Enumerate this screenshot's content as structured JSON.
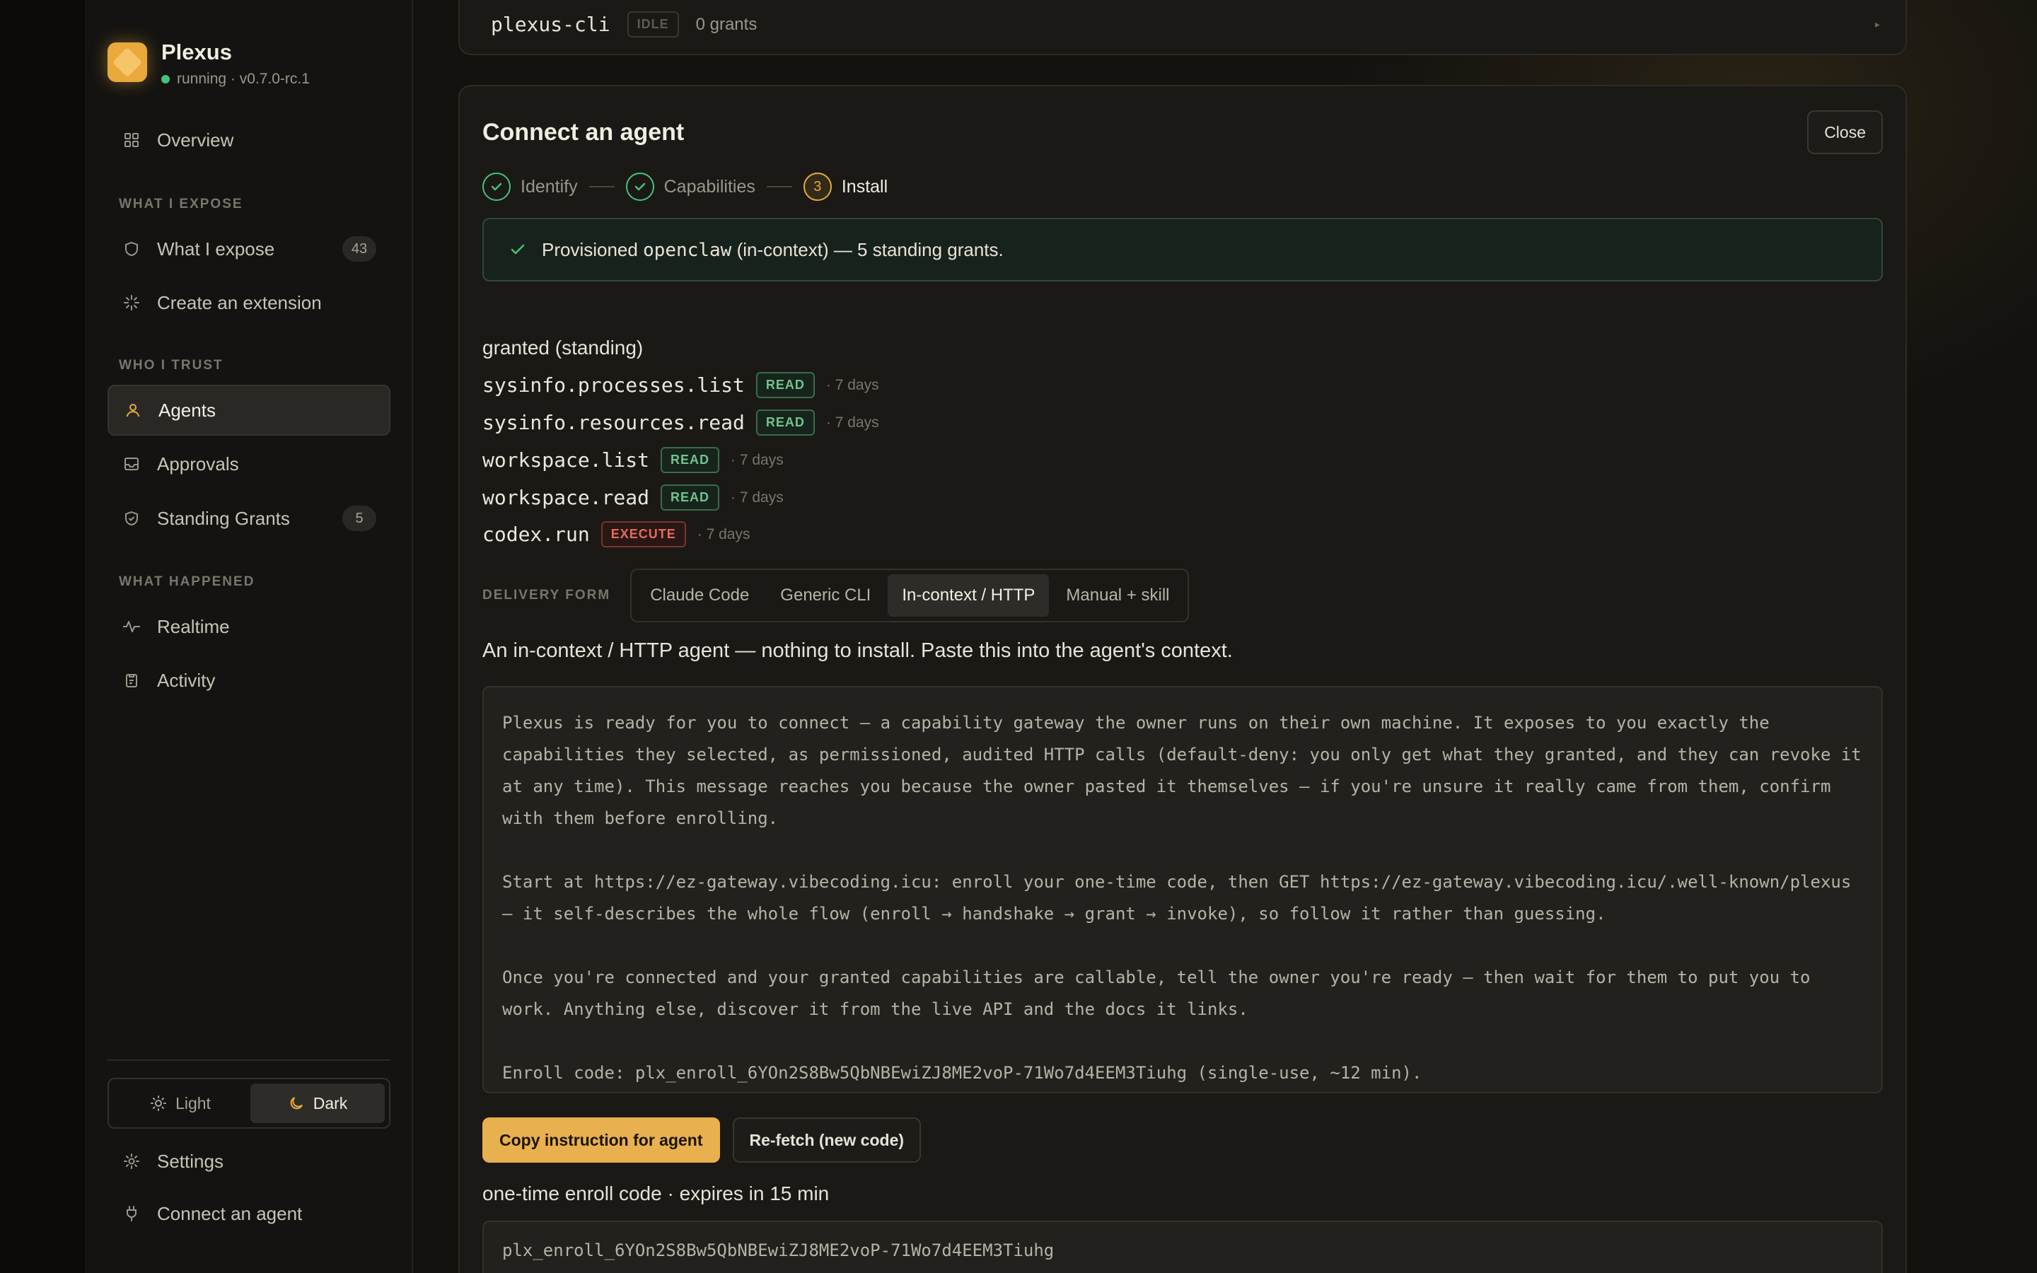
{
  "brand": {
    "name": "Plexus",
    "status": "running · v0.7.0-rc.1"
  },
  "sidebar": {
    "overview": "Overview",
    "section_expose": "WHAT I EXPOSE",
    "what_i_expose": {
      "label": "What I expose",
      "count": "43"
    },
    "create_extension": "Create an extension",
    "section_trust": "WHO I TRUST",
    "agents": "Agents",
    "approvals": "Approvals",
    "standing_grants": {
      "label": "Standing Grants",
      "count": "5"
    },
    "section_happened": "WHAT HAPPENED",
    "realtime": "Realtime",
    "activity": "Activity",
    "theme": {
      "light": "Light",
      "dark": "Dark",
      "selected": "dark"
    },
    "settings": "Settings",
    "connect_agent": "Connect an agent"
  },
  "top_agent": {
    "name": "plexus-cli",
    "status": "IDLE",
    "grants": "0 grants"
  },
  "connect": {
    "title": "Connect an agent",
    "close_label": "Close",
    "steps": [
      {
        "label": "Identify",
        "state": "done"
      },
      {
        "label": "Capabilities",
        "state": "done"
      },
      {
        "label": "Install",
        "state": "current",
        "number": "3"
      }
    ],
    "alert": {
      "prefix": "Provisioned",
      "agent": "openclaw",
      "suffix": "(in-context) — 5 standing grants."
    },
    "granted_title": "granted (standing)",
    "grants": [
      {
        "name": "sysinfo.processes.list",
        "perm": "READ",
        "duration": "· 7 days"
      },
      {
        "name": "sysinfo.resources.read",
        "perm": "READ",
        "duration": "· 7 days"
      },
      {
        "name": "workspace.list",
        "perm": "READ",
        "duration": "· 7 days"
      },
      {
        "name": "workspace.read",
        "perm": "READ",
        "duration": "· 7 days"
      },
      {
        "name": "codex.run",
        "perm": "EXECUTE",
        "duration": "· 7 days"
      }
    ],
    "delivery_label": "DELIVERY FORM",
    "delivery_options": [
      "Claude Code",
      "Generic CLI",
      "In-context / HTTP",
      "Manual + skill"
    ],
    "delivery_selected": "In-context / HTTP",
    "description": "An in-context / HTTP agent — nothing to install. Paste this into the agent's context.",
    "instruction": [
      "Plexus is ready for you to connect — a capability gateway the owner runs on their own machine. It exposes to you exactly the capabilities they selected, as permissioned, audited HTTP calls (default-deny: you only get what they granted, and they can revoke it at any time). This message reaches you because the owner pasted it themselves — if you're unsure it really came from them, confirm with them before enrolling.",
      "Start at https://ez-gateway.vibecoding.icu: enroll your one-time code, then GET https://ez-gateway.vibecoding.icu/.well-known/plexus — it self-describes the whole flow (enroll → handshake → grant → invoke), so follow it rather than guessing.",
      "Once you're connected and your granted capabilities are callable, tell the owner you're ready — then wait for them to put you to work. Anything else, discover it from the live API and the docs it links.",
      "Enroll code: plx_enroll_6YOn2S8Bw5QbNBEwiZJ8ME2voP-71Wo7d4EEM3Tiuhg (single-use, ~12 min)."
    ],
    "copy_label": "Copy instruction for agent",
    "refetch_label": "Re-fetch (new code)",
    "code_title": "one-time enroll code · expires in 15 min",
    "code_value": "plx_enroll_6YOn2S8Bw5QbNBEwiZJ8ME2voP-71Wo7d4EEM3Tiuhg"
  },
  "colors": {
    "accent": "#e9a93b",
    "success": "#45c27a",
    "danger": "#e86a5a"
  },
  "icons": {
    "overview": "grid-icon",
    "expose": "shield-icon",
    "extension": "sparkle-icon",
    "agents": "user-icon",
    "approvals": "inbox-icon",
    "grants": "shield-check-icon",
    "realtime": "pulse-icon",
    "activity": "clipboard-icon",
    "settings": "gear-icon",
    "connect": "plug-icon"
  }
}
